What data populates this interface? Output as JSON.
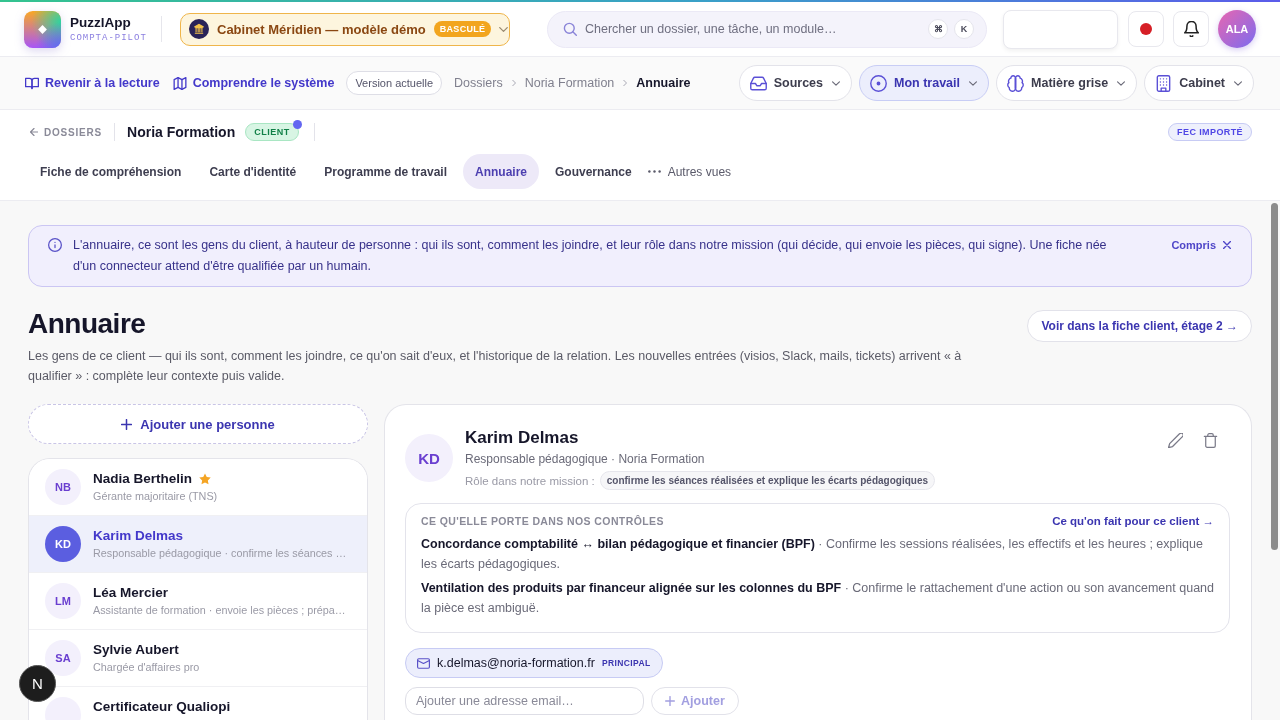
{
  "header": {
    "app_name": "PuzzlApp",
    "app_tagline": "COMPTA-PILOT",
    "workspace": {
      "label": "Cabinet Méridien — modèle démo",
      "badge": "BASCULÉ"
    },
    "search": {
      "placeholder": "Chercher un dossier, une tâche, un module…",
      "keys": [
        "⌘",
        "K"
      ]
    },
    "avatar": "ALA"
  },
  "nav": {
    "links": [
      "Revenir à la lecture",
      "Comprendre le système"
    ],
    "version": "Version actuelle",
    "breadcrumb": [
      {
        "label": "Dossiers",
        "current": false
      },
      {
        "label": "Noria Formation",
        "current": false
      },
      {
        "label": "Annuaire",
        "current": true
      }
    ],
    "menus": [
      {
        "label": "Sources",
        "selected": false
      },
      {
        "label": "Mon travail",
        "selected": true
      },
      {
        "label": "Matière grise",
        "selected": false
      },
      {
        "label": "Cabinet",
        "selected": false
      }
    ]
  },
  "dossier": {
    "back": "DOSSIERS",
    "name": "Noria Formation",
    "badge": "CLIENT",
    "status": "FEC IMPORTÉ"
  },
  "tabs": [
    {
      "label": "Fiche de compréhension",
      "selected": false
    },
    {
      "label": "Carte d'identité",
      "selected": false
    },
    {
      "label": "Programme de travail",
      "selected": false
    },
    {
      "label": "Annuaire",
      "selected": true
    },
    {
      "label": "Gouvernance",
      "selected": false
    }
  ],
  "more_tab": "Autres vues",
  "banner": {
    "text": "L'annuaire, ce sont les gens du client, à hauteur de personne : qui ils sont, comment les joindre, et leur rôle dans notre mission (qui décide, qui envoie les pièces, qui signe). Une fiche née d'un connecteur attend d'être qualifiée par un humain.",
    "dismiss": "Compris"
  },
  "page": {
    "title": "Annuaire",
    "description": "Les gens de ce client — qui ils sont, comment les joindre, ce qu'on sait d'eux, et l'historique de la relation. Les nouvelles entrées (visios, Slack, mails, tickets) arrivent « à qualifier » : complète leur contexte puis valide.",
    "link": "Voir dans la fiche client, étage 2 →"
  },
  "people": {
    "add": "Ajouter une personne",
    "list": [
      {
        "initials": "NB",
        "name": "Nadia Berthelin",
        "role": "Gérante majoritaire (TNS)",
        "starred": true,
        "selected": false
      },
      {
        "initials": "KD",
        "name": "Karim Delmas",
        "role": "Responsable pédagogique · confirme les séances …",
        "starred": false,
        "selected": true
      },
      {
        "initials": "LM",
        "name": "Léa Mercier",
        "role": "Assistante de formation · envoie les pièces ; prépa…",
        "starred": false,
        "selected": false
      },
      {
        "initials": "SA",
        "name": "Sylvie Aubert",
        "role": "Chargée d'affaires pro",
        "starred": false,
        "selected": false
      },
      {
        "name": "Certificateur Qualiopi",
        "starred": false,
        "selected": false
      }
    ]
  },
  "detail": {
    "initials": "KD",
    "name": "Karim Delmas",
    "subtitle": "Responsable pédagogique · Noria Formation",
    "role_label": "Rôle dans notre mission :",
    "role": "confirme les séances réalisées et explique les écarts pédagogiques",
    "controls": {
      "title": "CE QU'ELLE PORTE DANS NOS CONTRÔLES",
      "link": "Ce qu'on fait pour ce client →",
      "items": [
        "**Concordance comptabilité ↔ bilan pédagogique et financier (BPF)** · Confirme les sessions réalisées, les effectifs et les heures ; explique les écarts pédagogiques.",
        "**Ventilation des produits par financeur alignée sur les colonnes du BPF** · Confirme le rattachement d'une action ou son avancement quand la pièce est ambiguë."
      ]
    },
    "emails": [
      {
        "address": "k.delmas@noria-formation.fr",
        "badge": "PRINCIPAL"
      }
    ],
    "email_input": {
      "placeholder": "Ajouter une adresse email…"
    },
    "add_button": {
      "label": "Ajouter",
      "disabled": true
    }
  },
  "dev_button": "N"
}
